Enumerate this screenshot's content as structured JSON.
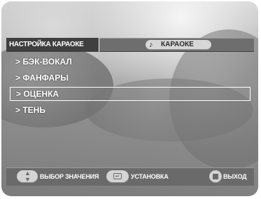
{
  "header": {
    "title": "НАСТРОЙКА КАРАОКЕ",
    "mode_label": "КАРАОКЕ",
    "mode_icon": "music-note-icon"
  },
  "menu": {
    "items": [
      {
        "label": "> БЭК-ВОКАЛ"
      },
      {
        "label": "> ФАНФАРЫ"
      },
      {
        "label": "> ОЦЕНКА",
        "selected": true
      },
      {
        "label": "> ТЕНЬ"
      }
    ]
  },
  "footer": {
    "select_value_label": "ВЫБОР ЗНАЧЕНИЯ",
    "select_value_icon": "up-down-arrows-icon",
    "set_label": "УСТАНОВКА",
    "set_icon": "enter-icon",
    "exit_label": "ВЫХОД",
    "exit_icon": "stop-icon"
  }
}
